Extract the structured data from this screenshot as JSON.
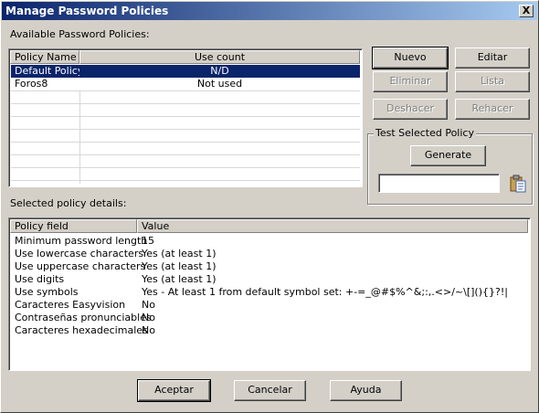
{
  "window": {
    "title": "Manage Password Policies",
    "close_glyph": "X"
  },
  "available": {
    "label": "Available Password Policies:",
    "columns": [
      "Policy Name",
      "Use count"
    ],
    "rows": [
      {
        "name": "Default Policy",
        "count": "N/D",
        "selected": true
      },
      {
        "name": "Foros8",
        "count": "Not used",
        "selected": false
      }
    ]
  },
  "buttons": {
    "nuevo": "Nuevo",
    "editar": "Editar",
    "eliminar": "Eliminar",
    "lista": "Lista",
    "deshacer": "Deshacer",
    "rehacer": "Rehacer"
  },
  "test": {
    "title": "Test Selected Policy",
    "generate": "Generate",
    "output_value": "",
    "clipboard_icon": "clipboard-icon"
  },
  "details": {
    "label": "Selected policy details:",
    "columns": [
      "Policy field",
      "Value"
    ],
    "rows": [
      {
        "field": "Minimum password length",
        "value": "15"
      },
      {
        "field": "Use lowercase characters",
        "value": "Yes (at least 1)"
      },
      {
        "field": "Use uppercase characters",
        "value": "Yes (at least 1)"
      },
      {
        "field": "Use digits",
        "value": "Yes (at least 1)"
      },
      {
        "field": "Use symbols",
        "value": "Yes - At least 1 from default symbol set: +-=_@#$%^&;:,.<>/~\\[](){}?!|"
      },
      {
        "field": "Caracteres Easyvision",
        "value": "No"
      },
      {
        "field": "Contraseñas pronunciables",
        "value": "No"
      },
      {
        "field": "Caracteres hexadecimales",
        "value": "No"
      }
    ]
  },
  "footer": {
    "aceptar": "Aceptar",
    "cancelar": "Cancelar",
    "ayuda": "Ayuda"
  },
  "colors": {
    "titlebar": "#0a246a",
    "selection": "#0a246a",
    "face": "#d4d0c8"
  }
}
